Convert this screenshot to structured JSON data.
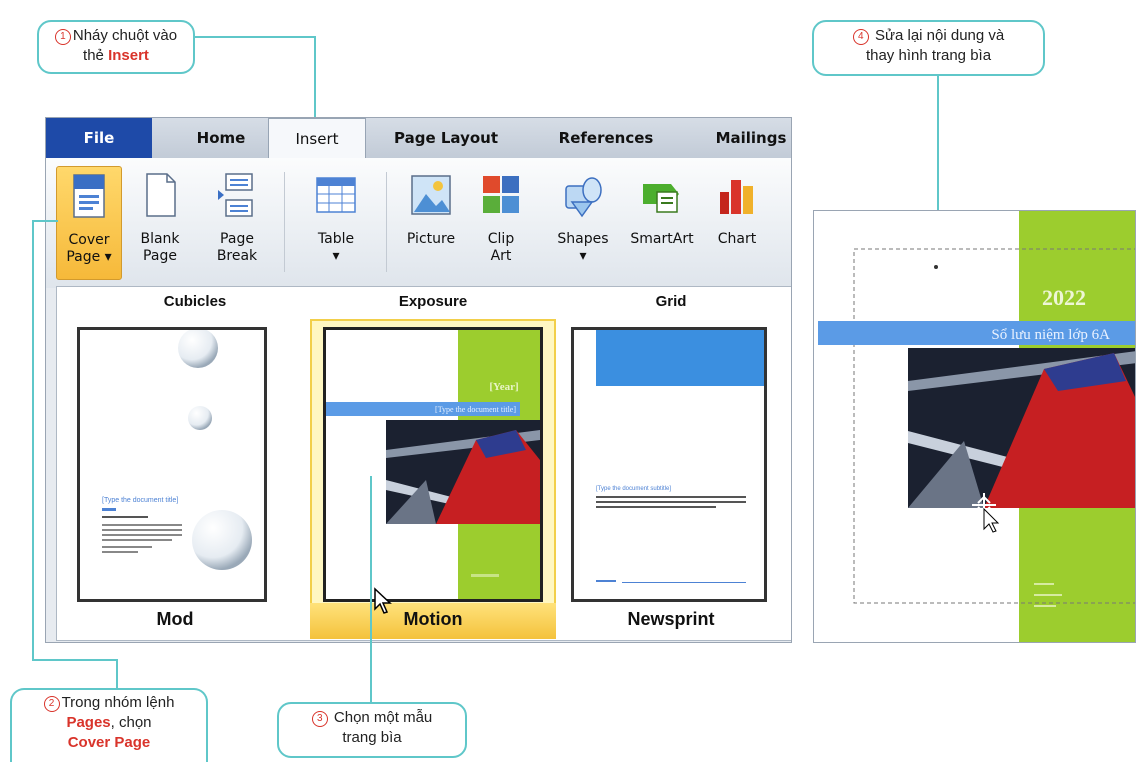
{
  "callouts": {
    "c1": {
      "num": "1",
      "line1": "Nháy chuột vào",
      "line2_pre": "thẻ ",
      "line2_red": "Insert"
    },
    "c2": {
      "num": "2",
      "line1": "Trong nhóm lệnh",
      "line2_red": "Pages",
      "line2_post": ", chọn",
      "line3_red": "Cover Page"
    },
    "c3": {
      "num": "3",
      "line1": "Chọn một mẫu",
      "line2": "trang bìa"
    },
    "c4": {
      "num": "4",
      "line1": "Sửa lại nội dung và",
      "line2": "thay hình trang bìa"
    }
  },
  "tabs": [
    "File",
    "Home",
    "Insert",
    "Page Layout",
    "References",
    "Mailings"
  ],
  "ribbon": {
    "cover": [
      "Cover",
      "Page ▾"
    ],
    "blank": [
      "Blank",
      "Page"
    ],
    "break": [
      "Page",
      "Break"
    ],
    "table": [
      "Table",
      "▾"
    ],
    "picture": [
      "Picture"
    ],
    "clipart": [
      "Clip",
      "Art"
    ],
    "shapes": [
      "Shapes",
      "▾"
    ],
    "smartart": [
      "SmartArt"
    ],
    "chart": [
      "Chart"
    ]
  },
  "gallery": {
    "headers": [
      "Cubicles",
      "Exposure",
      "Grid"
    ],
    "labels": [
      "Mod",
      "Motion",
      "Newsprint"
    ],
    "motion": {
      "year": "[Year]",
      "title": "[Type the document title]"
    },
    "mod": {
      "title": "[Type the document title]"
    },
    "newsprint": {
      "title": "[Type the document subtitle]"
    }
  },
  "cover_preview": {
    "year": "2022",
    "title": "Sổ lưu niệm lớp 6A"
  },
  "colors": {
    "accent_teal": "#5fc7c9",
    "green": "#9ccd2e",
    "blue_bar": "#5b9be6",
    "red": "#d9342b"
  }
}
